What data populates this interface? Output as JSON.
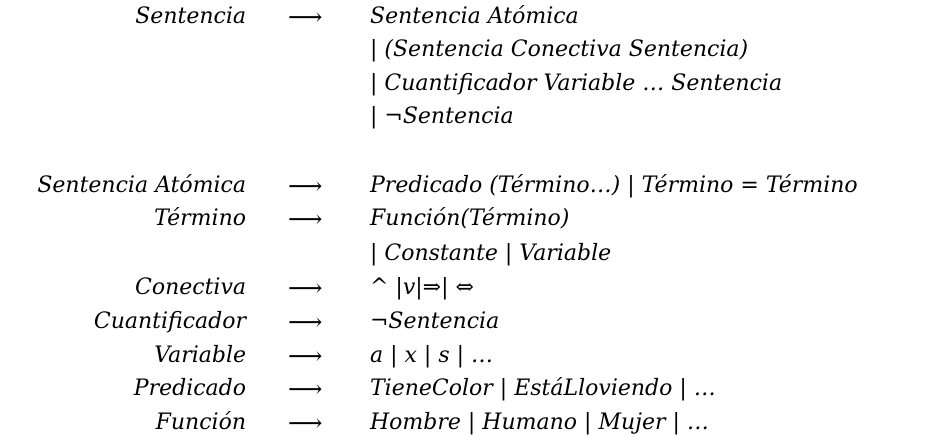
{
  "rules": [
    {
      "lhs": "Sentencia",
      "arrow": "⟶",
      "rhs": "Sentencia Atómica"
    },
    {
      "lhs": "",
      "arrow": "",
      "rhs": "| (Sentencia Conectiva Sentencia)"
    },
    {
      "lhs": "",
      "arrow": "",
      "rhs": "| Cuantificador Variable … Sentencia"
    },
    {
      "lhs": "",
      "arrow": "",
      "rhs": "| ¬Sentencia"
    },
    {
      "lhs": "Sentencia Atómica",
      "arrow": "⟶",
      "rhs": "Predicado (Término…) | Término = Término"
    },
    {
      "lhs": "Término",
      "arrow": "⟶",
      "rhs": "Función(Término)"
    },
    {
      "lhs": "",
      "arrow": "",
      "rhs": "| Constante | Variable"
    },
    {
      "lhs": "Conectiva",
      "arrow": "⟶",
      "rhs": "^ |v|⇒| ⇔"
    },
    {
      "lhs": "Cuantificador",
      "arrow": "⟶",
      "rhs": "¬Sentencia"
    },
    {
      "lhs": "Variable",
      "arrow": "⟶",
      "rhs": "a | x | s | …"
    },
    {
      "lhs": "Predicado",
      "arrow": "⟶",
      "rhs": "TieneColor | EstáLloviendo | …"
    },
    {
      "lhs": "Función",
      "arrow": "⟶",
      "rhs": "Hombre | Humano | Mujer | …"
    }
  ]
}
